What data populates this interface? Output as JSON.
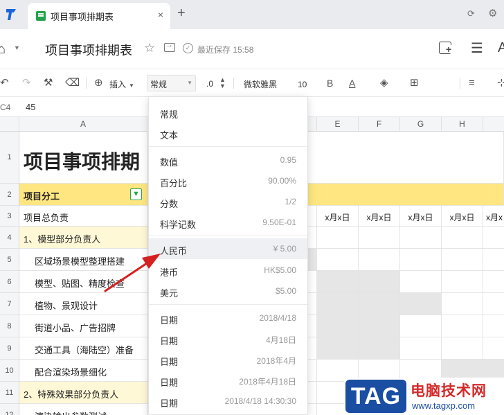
{
  "tabbar": {
    "tab_title": "项目事项排期表",
    "close_symbol": "×",
    "add_symbol": "+"
  },
  "titlebar": {
    "doc_title": "项目事项排期表",
    "saved_text": "最近保存 15:58",
    "font_a": "A"
  },
  "toolbar": {
    "insert_label": "插入",
    "format_value": "常规",
    "decimal_label": ".0",
    "font_name": "微软雅黑",
    "font_size": "10",
    "bold_label": "B",
    "font_color_label": "A"
  },
  "formula_bar": {
    "cell_ref": "C4",
    "value": "45"
  },
  "grid": {
    "columns": [
      "A",
      "E",
      "F",
      "G",
      "H"
    ],
    "rows": [
      {
        "num": "1",
        "a": "项目事项排期"
      },
      {
        "num": "2",
        "a": "项目分工"
      },
      {
        "num": "3",
        "a": "项目总负责"
      },
      {
        "num": "4",
        "a": "1、模型部分负责人"
      },
      {
        "num": "5",
        "a": "区域场景模型整理搭建"
      },
      {
        "num": "6",
        "a": "模型、贴图、精度检查"
      },
      {
        "num": "7",
        "a": "植物、景观设计"
      },
      {
        "num": "8",
        "a": "街道小品、广告招牌"
      },
      {
        "num": "9",
        "a": "交通工具（海陆空）准备"
      },
      {
        "num": "10",
        "a": "配合渲染场景细化"
      },
      {
        "num": "11",
        "a": "2、特殊效果部分负责人"
      },
      {
        "num": "12",
        "a": "渲染输出参数测试"
      }
    ],
    "date_header": "x月x日"
  },
  "format_dropdown": {
    "items": [
      {
        "label": "常规",
        "sample": ""
      },
      {
        "label": "文本",
        "sample": ""
      },
      {
        "label": "数值",
        "sample": "0.95"
      },
      {
        "label": "百分比",
        "sample": "90.00%"
      },
      {
        "label": "分数",
        "sample": "1/2"
      },
      {
        "label": "科学记数",
        "sample": "9.50E-01"
      },
      {
        "label": "人民币",
        "sample": "¥ 5.00"
      },
      {
        "label": "港币",
        "sample": "HK$5.00"
      },
      {
        "label": "美元",
        "sample": "$5.00"
      },
      {
        "label": "日期",
        "sample": "2018/4/18"
      },
      {
        "label": "日期",
        "sample": "4月18日"
      },
      {
        "label": "日期",
        "sample": "2018年4月"
      },
      {
        "label": "日期",
        "sample": "2018年4月18日"
      },
      {
        "label": "日期",
        "sample": "2018/4/18 14:30:30"
      }
    ],
    "highlighted": "人民币"
  },
  "watermark": {
    "tag": "TAG",
    "title": "电脑技术网",
    "url": "www.tagxp.com"
  },
  "colors": {
    "header_yellow": "#ffe680",
    "section_yellow": "#fff8d6",
    "accent_green": "#2aa84a",
    "arrow_red": "#d42020"
  }
}
